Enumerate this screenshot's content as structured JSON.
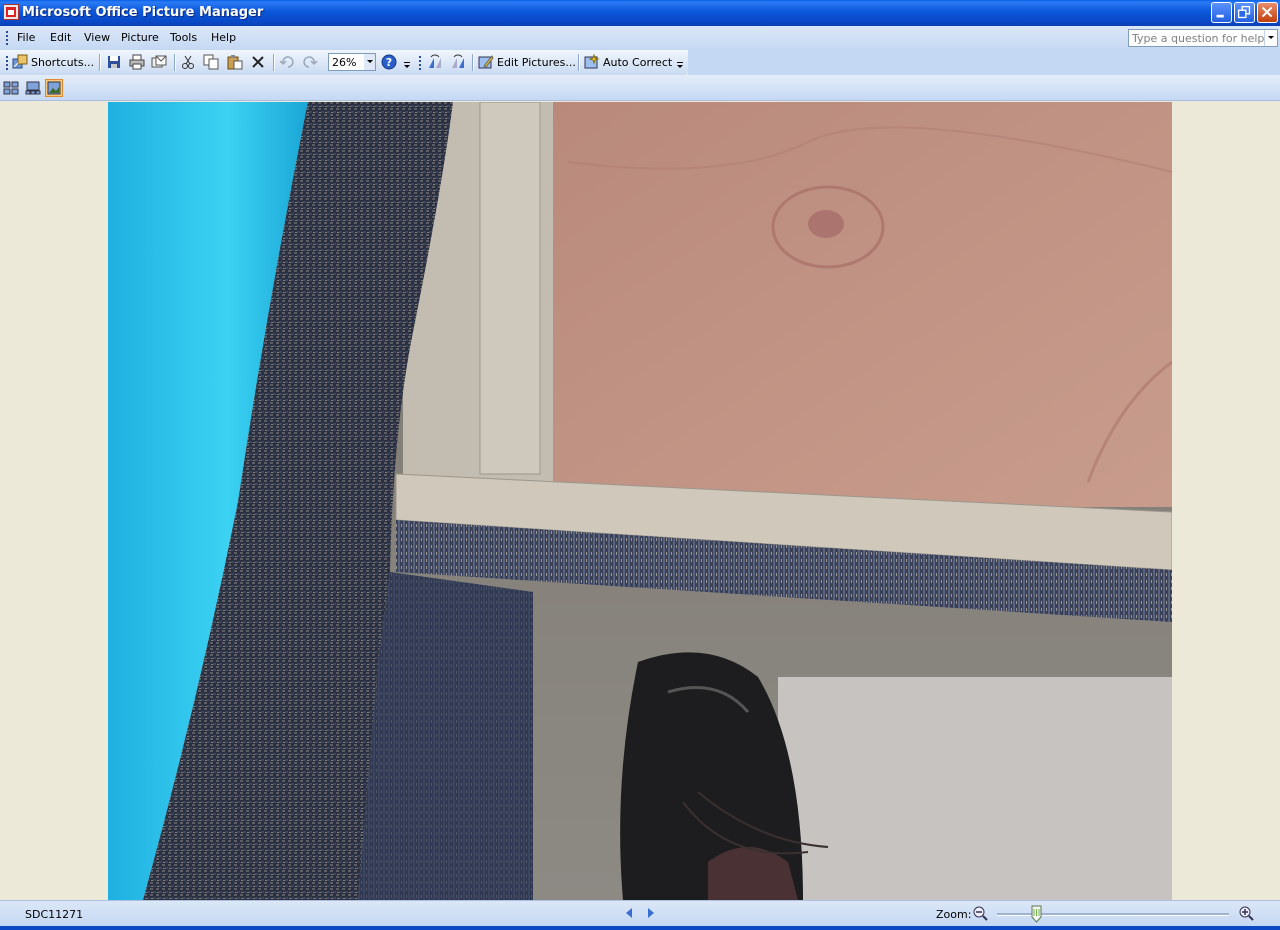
{
  "window": {
    "title": "Microsoft Office Picture Manager"
  },
  "menu": {
    "items": [
      "File",
      "Edit",
      "View",
      "Picture",
      "Tools",
      "Help"
    ]
  },
  "help_box": {
    "placeholder": "Type a question for help"
  },
  "toolbar": {
    "shortcuts_label": "Shortcuts...",
    "zoom_value": "26%",
    "edit_pictures_label": "Edit Pictures...",
    "auto_correct_label": "Auto Correct"
  },
  "status": {
    "filename": "SDC11271",
    "zoom_label": "Zoom:",
    "zoom_level": 0.17
  },
  "colors": {
    "accent": "#0a48c6",
    "active_view": "#f9c87a"
  },
  "icons": [
    "app-icon",
    "minimize-icon",
    "restore-icon",
    "close-icon",
    "save-icon",
    "print-icon",
    "mail-icon",
    "cut-icon",
    "copy-icon",
    "paste-icon",
    "delete-icon",
    "undo-icon",
    "redo-icon",
    "help-icon",
    "rotate-left-icon",
    "rotate-right-icon",
    "thumbnail-view-icon",
    "filmstrip-view-icon",
    "single-picture-view-icon",
    "previous-icon",
    "next-icon",
    "zoom-out-icon",
    "zoom-in-icon"
  ]
}
